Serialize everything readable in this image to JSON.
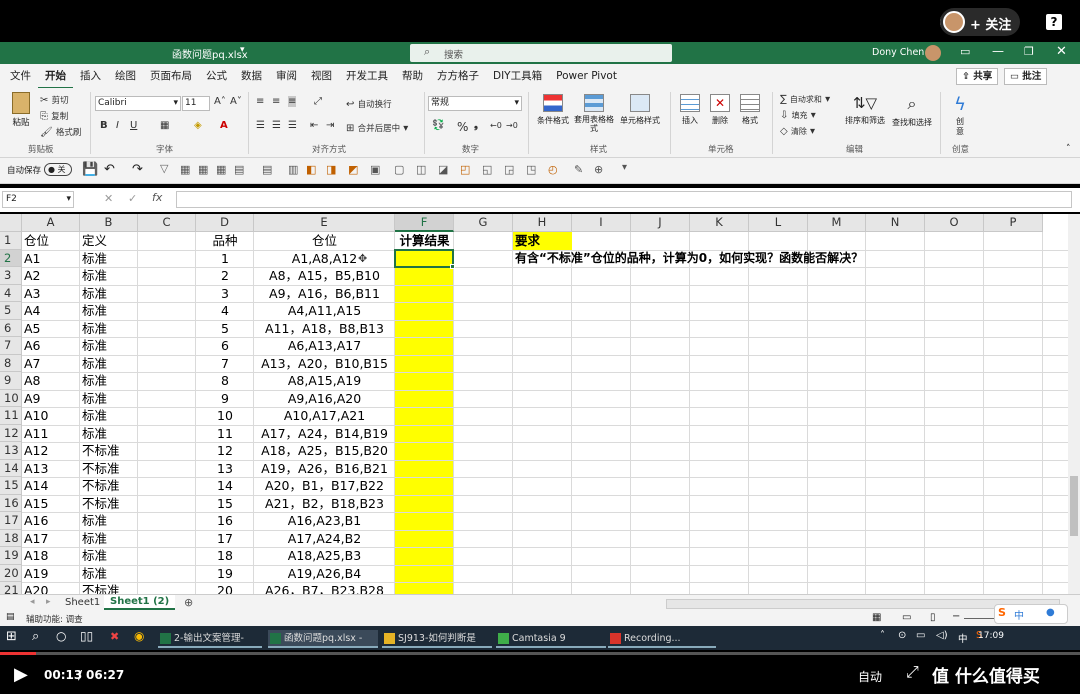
{
  "topbar": {
    "follow_label": "+ 关注",
    "help_label": "?"
  },
  "title": {
    "filename": "函数问题pq.xlsx",
    "search_placeholder": "搜索",
    "user": "Dony Chen"
  },
  "tabs": [
    "文件",
    "开始",
    "插入",
    "绘图",
    "页面布局",
    "公式",
    "数据",
    "审阅",
    "视图",
    "开发工具",
    "帮助",
    "方方格子",
    "DIY工具箱",
    "Power Pivot"
  ],
  "tabs_right": {
    "share": "共享",
    "comment": "批注"
  },
  "ribbon": {
    "clipboard": {
      "paste": "粘贴",
      "cut": "剪切",
      "copy": "复制",
      "format_painter": "格式刷",
      "group": "剪贴板"
    },
    "font": {
      "name": "Calibri",
      "size": "11",
      "group": "字体"
    },
    "alignment": {
      "wrap": "自动换行",
      "merge": "合并后居中",
      "group": "对齐方式"
    },
    "number": {
      "format": "常规",
      "group": "数字"
    },
    "styles": {
      "cond": "条件格式",
      "table": "套用表格格式",
      "cell": "单元格样式",
      "group": "样式"
    },
    "cells": {
      "insert": "插入",
      "delete": "删除",
      "format": "格式",
      "group": "单元格"
    },
    "editing": {
      "autosum": "自动求和",
      "fill": "填充",
      "clear": "清除",
      "sort": "排序和筛选",
      "find": "查找和选择",
      "group": "编辑"
    },
    "creative": {
      "label": "创意",
      "group": "创意"
    }
  },
  "qat": {
    "autosave": "自动保存",
    "autosave_state": "关"
  },
  "formula_bar": {
    "name_box": "F2",
    "fx": "fx",
    "formula": ""
  },
  "columns": [
    "A",
    "B",
    "C",
    "D",
    "E",
    "F",
    "G",
    "H",
    "I",
    "J",
    "K",
    "L",
    "M",
    "N",
    "O",
    "P"
  ],
  "header_row": {
    "A": "仓位",
    "B": "定义",
    "D": "品种",
    "E": "仓位",
    "F": "计算结果",
    "H": "要求"
  },
  "requirement_text": "有含“不标准”仓位的品种，计算为0，如何实现？函数能否解决？",
  "rows": [
    {
      "n": "2",
      "a": "A1",
      "b": "标准",
      "d": "1",
      "e": "A1,A8,A12"
    },
    {
      "n": "3",
      "a": "A2",
      "b": "标准",
      "d": "2",
      "e": "A8，A15，B5,B10"
    },
    {
      "n": "4",
      "a": "A3",
      "b": "标准",
      "d": "3",
      "e": "A9，A16，B6,B11"
    },
    {
      "n": "5",
      "a": "A4",
      "b": "标准",
      "d": "4",
      "e": "A4,A11,A15"
    },
    {
      "n": "6",
      "a": "A5",
      "b": "标准",
      "d": "5",
      "e": "A11，A18，B8,B13"
    },
    {
      "n": "7",
      "a": "A6",
      "b": "标准",
      "d": "6",
      "e": "A6,A13,A17"
    },
    {
      "n": "8",
      "a": "A7",
      "b": "标准",
      "d": "7",
      "e": "A13，A20，B10,B15"
    },
    {
      "n": "9",
      "a": "A8",
      "b": "标准",
      "d": "8",
      "e": "A8,A15,A19"
    },
    {
      "n": "10",
      "a": "A9",
      "b": "标准",
      "d": "9",
      "e": "A9,A16,A20"
    },
    {
      "n": "11",
      "a": "A10",
      "b": "标准",
      "d": "10",
      "e": "A10,A17,A21"
    },
    {
      "n": "12",
      "a": "A11",
      "b": "标准",
      "d": "11",
      "e": "A17，A24，B14,B19"
    },
    {
      "n": "13",
      "a": "A12",
      "b": "不标准",
      "d": "12",
      "e": "A18，A25，B15,B20"
    },
    {
      "n": "14",
      "a": "A13",
      "b": "不标准",
      "d": "13",
      "e": "A19，A26，B16,B21"
    },
    {
      "n": "15",
      "a": "A14",
      "b": "不标准",
      "d": "14",
      "e": "A20，B1，B17,B22"
    },
    {
      "n": "16",
      "a": "A15",
      "b": "不标准",
      "d": "15",
      "e": "A21，B2，B18,B23"
    },
    {
      "n": "17",
      "a": "A16",
      "b": "标准",
      "d": "16",
      "e": "A16,A23,B1"
    },
    {
      "n": "18",
      "a": "A17",
      "b": "标准",
      "d": "17",
      "e": "A17,A24,B2"
    },
    {
      "n": "19",
      "a": "A18",
      "b": "标准",
      "d": "18",
      "e": "A18,A25,B3"
    },
    {
      "n": "20",
      "a": "A19",
      "b": "标准",
      "d": "19",
      "e": "A19,A26,B4"
    },
    {
      "n": "21",
      "a": "A20",
      "b": "不标准",
      "d": "20",
      "e": "A26，B7，B23,B28"
    }
  ],
  "sheets": [
    "Sheet1",
    "Sheet1 (2)"
  ],
  "status": {
    "accessibility": "辅助功能: 调查"
  },
  "taskbar": {
    "items": [
      "2-输出文案管理-hon...",
      "函数问题pq.xlsx - Ex...",
      "SJ913-如何判断是否...",
      "Camtasia 9",
      "Recording..."
    ],
    "ime": "中",
    "clock": "17:09"
  },
  "player": {
    "current": "00:13",
    "total": "06:27",
    "quality": "自动",
    "brand": "值 什么值得买"
  },
  "colors": {
    "excel_green": "#217346",
    "highlight": "#ffff00",
    "taskbar": "#1d2a37"
  }
}
